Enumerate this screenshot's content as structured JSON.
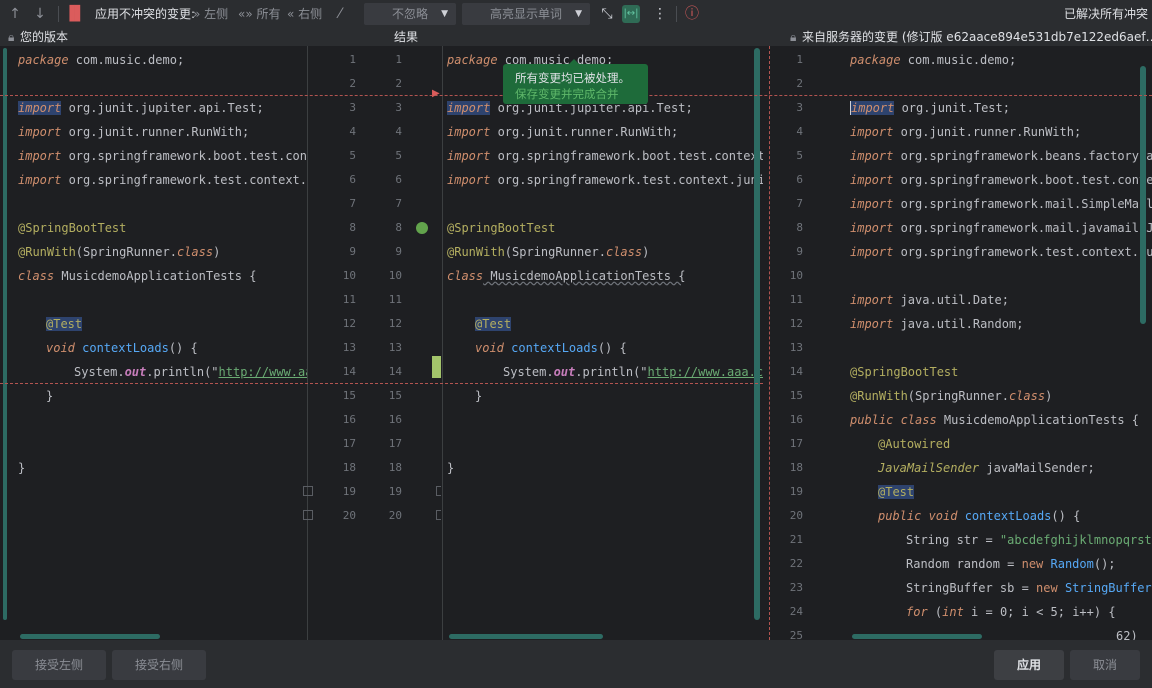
{
  "toolbar": {
    "apply_nonconflict_label": "应用不冲突的变更:",
    "left_label": "左侧",
    "all_label": "所有",
    "right_label": "右侧",
    "ignore_dropdown": "不忽略",
    "highlight_dropdown": "高亮显示单词",
    "status": "已解决所有冲突"
  },
  "header": {
    "left_title": "您的版本",
    "center_title": "结果",
    "right_title": "来自服务器的变更 (修订版 e62aace894e531db7e122ed6aef…"
  },
  "tooltip": {
    "message": "所有变更均已被处理。",
    "link": "保存变更并完成合并"
  },
  "left_lines": [
    "1",
    "2",
    "3",
    "4",
    "5",
    "6",
    "7",
    "8",
    "9",
    "10",
    "11",
    "12",
    "13",
    "14",
    "15",
    "16",
    "17",
    "18",
    "19",
    "20"
  ],
  "center_lines": [
    "1",
    "2",
    "3",
    "4",
    "5",
    "6",
    "7",
    "8",
    "9",
    "10",
    "11",
    "12",
    "13",
    "14",
    "15",
    "16",
    "17",
    "18",
    "19",
    "20"
  ],
  "right_lines": [
    "1",
    "2",
    "3",
    "4",
    "5",
    "6",
    "7",
    "8",
    "9",
    "10",
    "11",
    "12",
    "13",
    "14",
    "15",
    "16",
    "17",
    "18",
    "19",
    "20",
    "21",
    "22",
    "23",
    "24",
    "25"
  ],
  "left_code": {
    "l1_kw": "package",
    "l1_rest": " com.music.demo;",
    "l3_kw": "import",
    "l3_rest": " org.junit.jupiter.api.",
    "l3_cls": "Test",
    "l3_end": ";",
    "l4_kw": "import",
    "l4_rest": " org.junit.runner.",
    "l4_cls": "RunWith",
    "l4_end": ";",
    "l5_kw": "import",
    "l5_rest": " org.springframework.boot.test.cont",
    "l6_kw": "import",
    "l6_rest": " org.springframework.test.context.j",
    "l8": "@SpringBootTest",
    "l9_an": "@RunWith",
    "l9_rest": "(SpringRunner.",
    "l9_kw": "class",
    "l9_end": ")",
    "l10_kw": "class",
    "l10_rest": " MusicdemoApplicationTests {",
    "l12": "@Test",
    "l13_kw": "void",
    "l13_fn": " contextLoads",
    "l13_rest": "() {",
    "l14_a": "System.",
    "l14_fld": "out",
    "l14_b": ".println(\"",
    "l14_str": "http://www.aa",
    "l15": "}",
    "l18": "}"
  },
  "center_code": {
    "l1_kw": "package",
    "l1_rest": " com.music.demo;",
    "l3_kw": "import",
    "l3_rest": " org.junit.jupiter.api.",
    "l3_cls": "Test",
    "l3_end": ";",
    "l4_kw": "import",
    "l4_rest": " org.junit.runner.",
    "l4_cls": "RunWith",
    "l4_end": ";",
    "l5_kw": "import",
    "l5_rest": " org.springframework.boot.test.context.",
    "l6_kw": "import",
    "l6_rest": " org.springframework.test.context.junit",
    "l8": "@SpringBootTest",
    "l9_an": "@RunWith",
    "l9_rest": "(SpringRunner.",
    "l9_kw": "class",
    "l9_end": ")",
    "l10_kw": "class",
    "l10_rest": " MusicdemoApplicationTests {",
    "l12": "@Test",
    "l13_kw": "void",
    "l13_fn": " contextLoads",
    "l13_rest": "() {",
    "l14_a": "System.",
    "l14_fld": "out",
    "l14_b": ".println(\"",
    "l14_str": "http://www.aaa.co",
    "l15": "}",
    "l18": "}"
  },
  "right_code": {
    "l1_kw": "package",
    "l1_rest": " com.music.demo;",
    "l3_kw": "import",
    "l3_rest": " org.junit.",
    "l3_cls": "Test",
    "l3_end": ";",
    "l4_kw": "import",
    "l4_rest": " org.junit.runner.",
    "l4_cls": "RunWith",
    "l4_end": ";",
    "l5_kw": "import",
    "l5_rest": " org.springframework.beans.factory.an",
    "l6_kw": "import",
    "l6_rest": " org.springframework.boot.test.contex",
    "l7_kw": "import",
    "l7_rest": " org.springframework.mail.SimpleMailM",
    "l8_kw": "import",
    "l8_rest": " org.springframework.mail.javamail.Ja",
    "l9_kw": "import",
    "l9_rest": " org.springframework.test.context.jun",
    "l11_kw": "import",
    "l11_rest": " java.util.",
    "l11_cls": "Date",
    "l11_end": ";",
    "l12_kw": "import",
    "l12_rest": " java.util.",
    "l12_cls": "Random",
    "l12_end": ";",
    "l14": "@SpringBootTest",
    "l15_an": "@RunWith",
    "l15_rest": "(SpringRunner.",
    "l15_kw": "class",
    "l15_end": ")",
    "l16_kw": "public class",
    "l16_rest": " MusicdemoApplicationTests {",
    "l17": "@Autowired",
    "l18_ty": "JavaMailSender",
    "l18_rest": " javaMailSender;",
    "l19": "@Test",
    "l20_kw": "public void",
    "l20_fn": " contextLoads",
    "l20_rest": "() {",
    "l21_a": "String str = ",
    "l21_str": "\"abcdefghijklmnopqrstu",
    "l22_a": "Random random = ",
    "l22_kw": "new",
    "l22_fn": " Random",
    "l22_rest": "();",
    "l23_a": "StringBuffer sb = ",
    "l23_kw": "new",
    "l23_fn": " StringBuffer",
    "l23_rest": "(",
    "l24_kw": "for",
    "l24_a": " (",
    "l24_kw2": "int",
    "l24_b": " i = 0; i < 5; i++) {",
    "l25": "62)"
  },
  "footer": {
    "accept_left": "接受左侧",
    "accept_right": "接受右侧",
    "apply": "应用",
    "cancel": "取消"
  }
}
